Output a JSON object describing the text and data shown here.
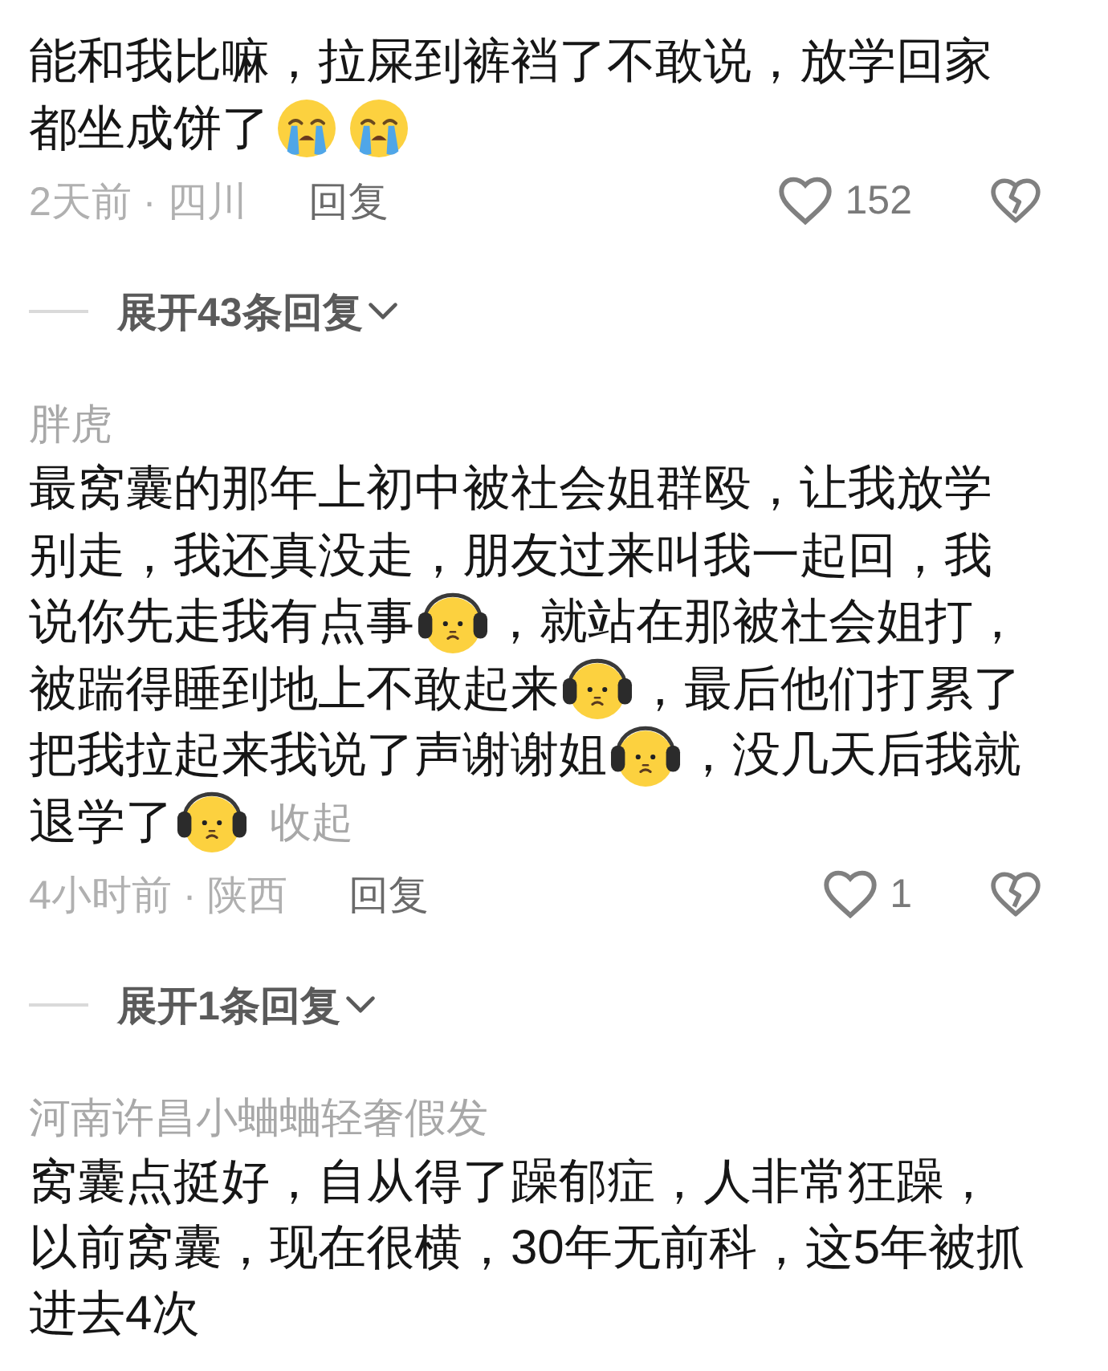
{
  "comments": [
    {
      "lines": [
        [
          {
            "kind": "text",
            "text": "能和我比嘛，拉屎到裤裆了不敢说，放学回家"
          }
        ],
        [
          {
            "kind": "text",
            "text": "都坐成饼了"
          },
          {
            "kind": "emoji_crying"
          },
          {
            "kind": "emoji_crying"
          }
        ]
      ],
      "time_location": "2天前 · 四川",
      "reply": "回复",
      "liked": false,
      "likes": "152",
      "disliked": false,
      "expand_replies": "展开43条回复"
    },
    {
      "username": "胖虎",
      "lines": [
        [
          {
            "kind": "text",
            "text": "最窝囊的那年上初中被社会姐群殴，让我放学"
          }
        ],
        [
          {
            "kind": "text",
            "text": "别走，我还真没走，朋友过来叫我一起回，我"
          }
        ],
        [
          {
            "kind": "text",
            "text": "说你先走我有点事"
          },
          {
            "kind": "emoji_headphones"
          },
          {
            "kind": "text",
            "text": "，就站在那被社会姐打，"
          }
        ],
        [
          {
            "kind": "text",
            "text": "被踹得睡到地上不敢起来"
          },
          {
            "kind": "emoji_headphones"
          },
          {
            "kind": "text",
            "text": "，最后他们打累了"
          }
        ],
        [
          {
            "kind": "text",
            "text": "把我拉起来我说了声谢谢姐"
          },
          {
            "kind": "emoji_headphones"
          },
          {
            "kind": "text",
            "text": "，没几天后我就"
          }
        ],
        [
          {
            "kind": "text",
            "text": "退学了"
          },
          {
            "kind": "emoji_headphones"
          }
        ]
      ],
      "collapse": "收起",
      "time_location": "4小时前 · 陕西",
      "reply": "回复",
      "liked": false,
      "likes": "1",
      "disliked": false,
      "expand_replies": "展开1条回复"
    },
    {
      "username": "河南许昌小蛐蛐轻奢假发",
      "text": "窝囊点挺好，自从得了躁郁症，人非常狂躁，以前窝囊，现在很横，30年无前科，这5年被抓进去4次"
    }
  ]
}
